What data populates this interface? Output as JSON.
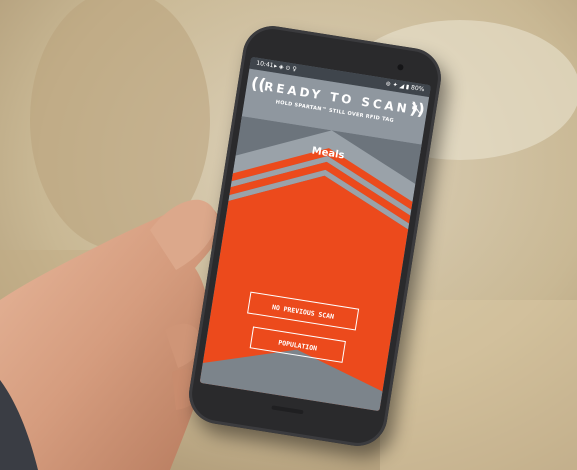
{
  "status_bar": {
    "time": "10:41",
    "left_icons": "▸ ◈ ⊙ ♀",
    "right_icons": "⊚ ✦ ◢ ▮ 80%"
  },
  "header": {
    "title": "READY TO SCAN",
    "subtitle": "HOLD SPARTAN™ STILL OVER RFID TAG",
    "sound_icon": "sound-off-icon"
  },
  "main": {
    "section_label": "Meals"
  },
  "buttons": {
    "no_previous_scan": "NO PREVIOUS SCAN",
    "population": "POPULATION"
  },
  "colors": {
    "accent_orange": "#ec4a1c",
    "panel_gray": "#8f979f",
    "dark_gray": "#5f6770",
    "phone_body": "#2a2a2c"
  }
}
